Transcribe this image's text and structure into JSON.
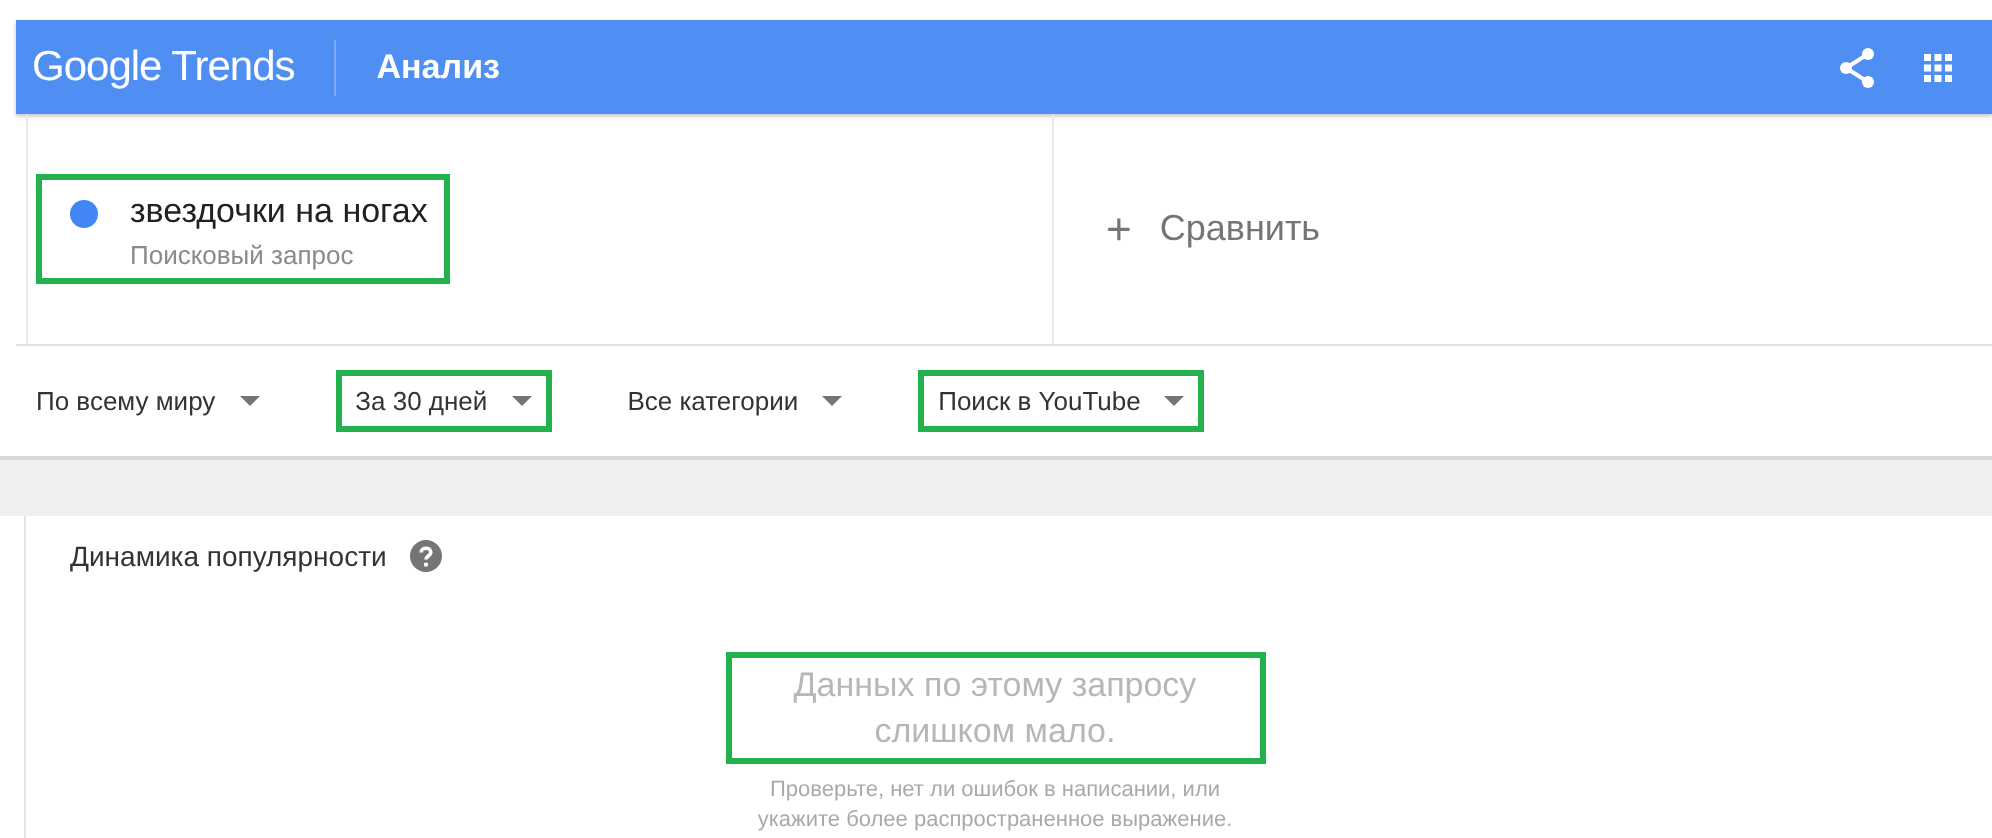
{
  "header": {
    "logo": "Google Trends",
    "title": "Анализ"
  },
  "term": {
    "name": "звездочки на ногах",
    "type": "Поисковый запрос",
    "color": "#4285f4",
    "highlighted": true
  },
  "compare": {
    "icon": "+",
    "label": "Сравнить"
  },
  "filters": [
    {
      "label": "По всему миру",
      "highlighted": false
    },
    {
      "label": "За 30 дней",
      "highlighted": true
    },
    {
      "label": "Все категории",
      "highlighted": false
    },
    {
      "label": "Поиск в YouTube",
      "highlighted": true
    }
  ],
  "panel": {
    "title": "Динамика популярности",
    "message": "Данных по этому запросу слишком мало.",
    "message_highlighted": true,
    "hint": "Проверьте, нет ли ошибок в написании, или укажите более распространенное выражение."
  }
}
